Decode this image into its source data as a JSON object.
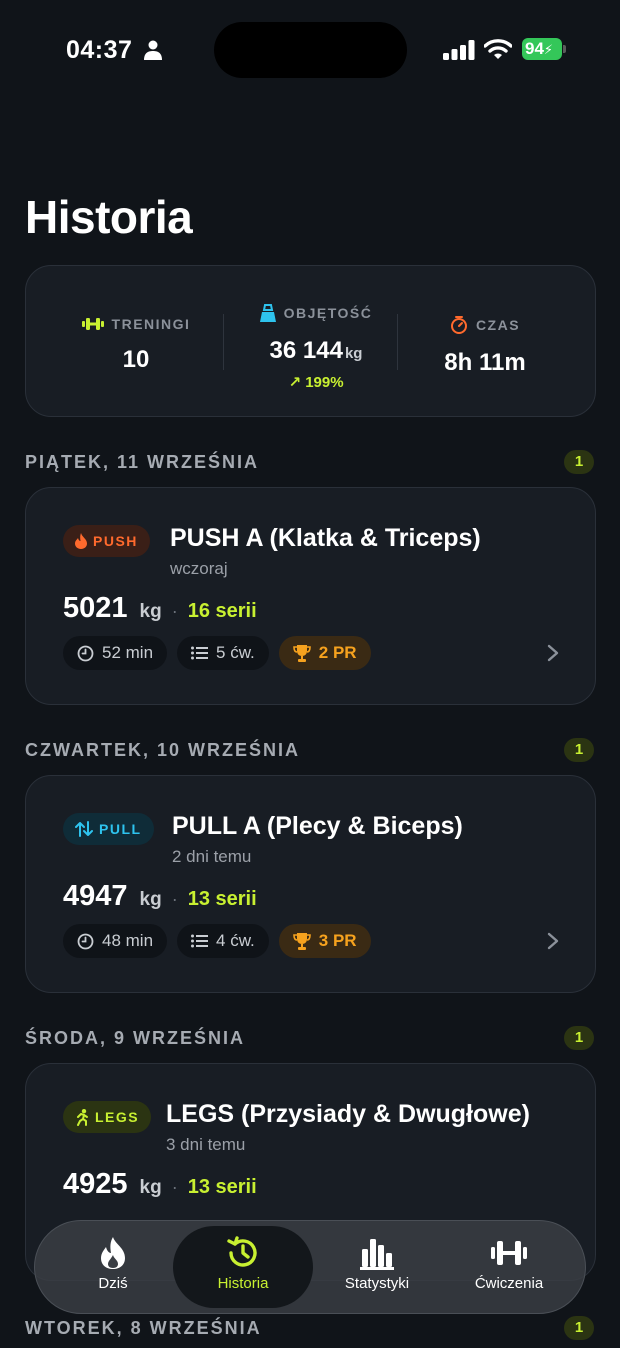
{
  "status_bar": {
    "time": "04:37",
    "battery": "94"
  },
  "page": {
    "title": "Historia"
  },
  "summary": {
    "workouts": {
      "label": "TRENINGI",
      "value": "10"
    },
    "volume": {
      "label": "OBJĘTOŚĆ",
      "value": "36 144",
      "unit": "kg",
      "trend": "199%"
    },
    "time": {
      "label": "CZAS",
      "value": "8h 11m"
    }
  },
  "days": [
    {
      "header": "PIĄTEK, 11 WRZEŚNIA",
      "count": "1"
    },
    {
      "header": "CZWARTEK, 10 WRZEŚNIA",
      "count": "1"
    },
    {
      "header": "ŚRODA, 9 WRZEŚNIA",
      "count": "1"
    },
    {
      "header": "WTOREK, 8 WRZEŚNIA",
      "count": "1"
    }
  ],
  "workouts": [
    {
      "badge": "PUSH",
      "title": "PUSH A (Klatka & Triceps)",
      "when": "wczoraj",
      "volume": "5021",
      "unit": "kg",
      "dot": "·",
      "sets": "16 serii",
      "duration": "52 min",
      "exercises": "5 ćw.",
      "prs": "2 PR"
    },
    {
      "badge": "PULL",
      "title": "PULL A (Plecy & Biceps)",
      "when": "2 dni temu",
      "volume": "4947",
      "unit": "kg",
      "dot": "·",
      "sets": "13 serii",
      "duration": "48 min",
      "exercises": "4 ćw.",
      "prs": "3 PR"
    },
    {
      "badge": "LEGS",
      "title": "LEGS (Przysiady & Dwugłowe)",
      "when": "3 dni temu",
      "volume": "4925",
      "unit": "kg",
      "dot": "·",
      "sets": "13 serii"
    }
  ],
  "tabs": [
    {
      "label": "Dziś",
      "icon": "flame-icon"
    },
    {
      "label": "Historia",
      "icon": "history-icon",
      "active": true
    },
    {
      "label": "Statystyki",
      "icon": "bar-chart-icon"
    },
    {
      "label": "Ćwiczenia",
      "icon": "dumbbell-icon"
    }
  ],
  "colors": {
    "accent": "#c8f031",
    "push": "#ff6a2d",
    "pull": "#2ec3ee",
    "pr": "#f6a21e",
    "background": "#101419",
    "card": "#181d24"
  }
}
